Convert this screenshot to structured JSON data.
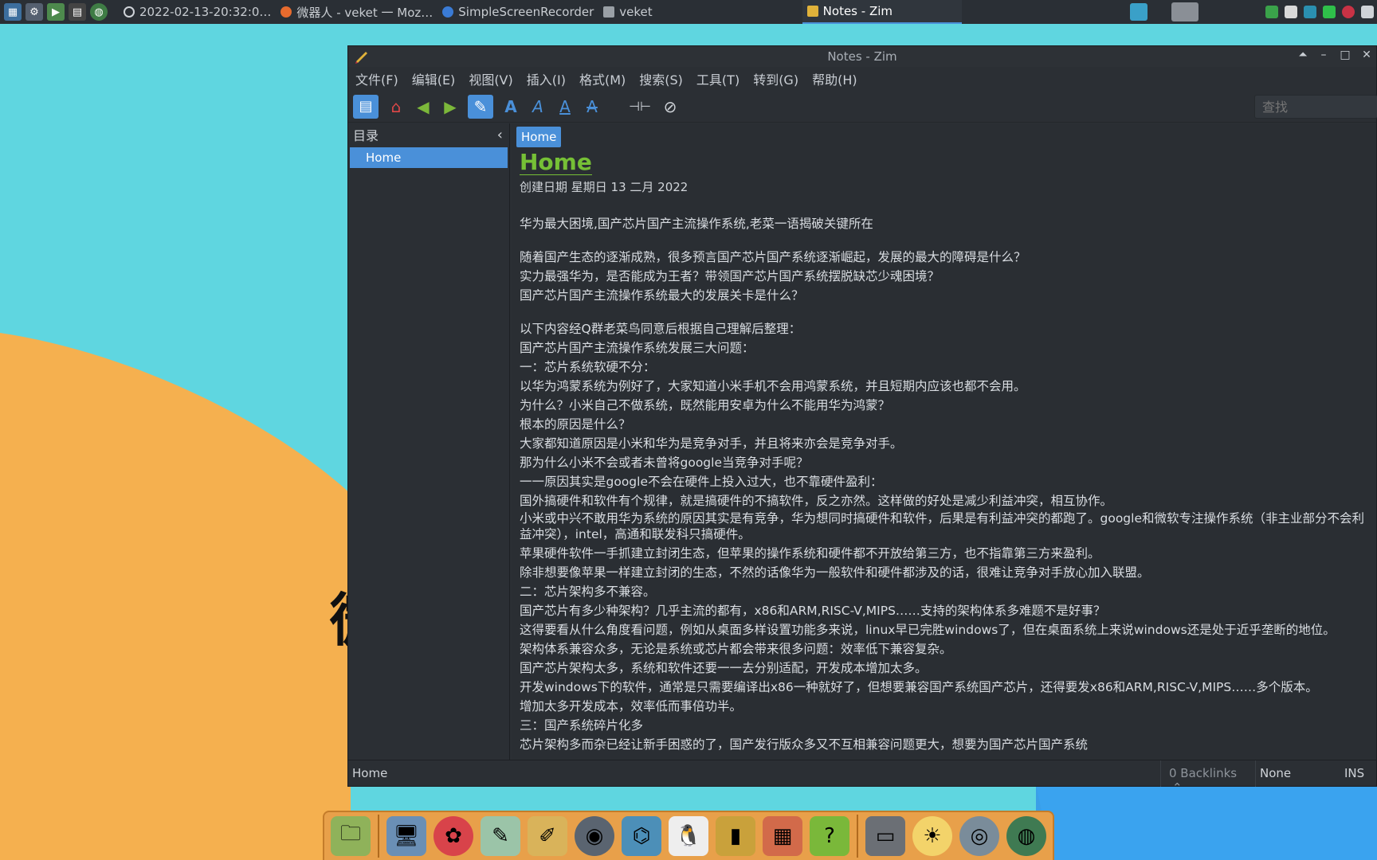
{
  "taskbar": {
    "launchers": [
      "system-monitor-icon",
      "settings-icon",
      "media-player-icon",
      "terminal-icon",
      "browser-icon"
    ],
    "tasks": [
      {
        "label": "2022-02-13-20:32:0…",
        "icon": "recording-icon",
        "color": "#cfd3d8"
      },
      {
        "label": "微器人 - veket 一 Moz…",
        "icon": "firefox-icon",
        "color": "#e76b2e"
      },
      {
        "label": "SimpleScreenRecorder",
        "icon": "recorder-icon",
        "color": "#3a7bd5"
      },
      {
        "label": "veket",
        "icon": "folder-icon",
        "color": "#9aa0a6"
      },
      {
        "label": "Notes - Zim",
        "icon": "zim-icon",
        "color": "#e0b23a",
        "active": true
      }
    ]
  },
  "window": {
    "title": "Notes - Zim",
    "menu": [
      "文件(F)",
      "编辑(E)",
      "视图(V)",
      "插入(I)",
      "格式(M)",
      "搜索(S)",
      "工具(T)",
      "转到(G)",
      "帮助(H)"
    ],
    "search_placeholder": "查找"
  },
  "sidebar": {
    "header": "目录",
    "items": [
      "Home"
    ]
  },
  "page": {
    "breadcrumb": "Home",
    "heading": "Home",
    "created": "创建日期 星期日 13 二月 2022",
    "paragraphs": [
      [
        "华为最大困境,国产芯片国产主流操作系统,老菜一语揭破关键所在"
      ],
      [
        "随着国产生态的逐渐成熟，很多预言国产芯片国产系统逐渐崛起，发展的最大的障碍是什么？",
        "实力最强华为，是否能成为王者？带领国产芯片国产系统摆脱缺芯少魂困境？",
        "国产芯片国产主流操作系统最大的发展关卡是什么？"
      ],
      [
        "以下内容经Q群老菜鸟同意后根据自己理解后整理：",
        "国产芯片国产主流操作系统发展三大问题：",
        "一：芯片系统软硬不分：",
        "以华为鸿蒙系统为例好了，大家知道小米手机不会用鸿蒙系统，并且短期内应该也都不会用。",
        "为什么？小米自己不做系统，既然能用安卓为什么不能用华为鸿蒙？",
        "根本的原因是什么？",
        "大家都知道原因是小米和华为是竞争对手，并且将来亦会是竞争对手。",
        "那为什么小米不会或者未曾将google当竞争对手呢？",
        "一一原因其实是google不会在硬件上投入过大，也不靠硬件盈利：",
        "国外搞硬件和软件有个规律，就是搞硬件的不搞软件，反之亦然。这样做的好处是减少利益冲突，相互协作。",
        "小米或中兴不敢用华为系统的原因其实是有竞争，华为想同时搞硬件和软件，后果是有利益冲突的都跑了。google和微软专注操作系统（非主业部分不会利益冲突），intel，高通和联发科只搞硬件。",
        "苹果硬件软件一手抓建立封闭生态，但苹果的操作系统和硬件都不开放给第三方，也不指靠第三方来盈利。",
        "除非想要像苹果一样建立封闭的生态，不然的话像华为一般软件和硬件都涉及的话，很难让竞争对手放心加入联盟。",
        "二：芯片架构多不兼容。",
        "国产芯片有多少种架构？几乎主流的都有，x86和ARM,RISC-V,MIPS……支持的架构体系多难题不是好事？",
        "这得要看从什么角度看问题，例如从桌面多样设置功能多来说，linux早已完胜windows了，但在桌面系统上来说windows还是处于近乎垄断的地位。",
        "架构体系兼容众多，无论是系统或芯片都会带来很多问题：效率低下兼容复杂。",
        "国产芯片架构太多，系统和软件还要一一去分别适配，开发成本增加太多。",
        "开发windows下的软件，通常是只需要编译出x86一种就好了，但想要兼容国产系统国产芯片，还得要发x86和ARM,RISC-V,MIPS……多个版本。",
        "增加太多开发成本，效率低而事倍功半。",
        "三：国产系统碎片化多",
        "芯片架构多而杂已经让新手困惑的了，国产发行版众多又不互相兼容问题更大，想要为国产芯片国产系统"
      ]
    ]
  },
  "statusbar": {
    "page": "Home",
    "backlinks": "0 Backlinks",
    "style": "None",
    "mode": "INS"
  },
  "dock": {
    "items": [
      "file-manager-icon",
      "monitor-icon",
      "mascot-icon",
      "editor-icon",
      "paint-icon",
      "disk-icon",
      "network-icon",
      "penguin-icon",
      "book-icon",
      "chart-icon",
      "help-icon",
      "tray-icon",
      "sun-icon",
      "globe-icon",
      "planet-icon"
    ]
  },
  "colors": {
    "accent": "#4a90d9",
    "heading": "#76c036",
    "desktop_cyan": "#5fd6e0",
    "desktop_orange": "#f5b04f"
  }
}
